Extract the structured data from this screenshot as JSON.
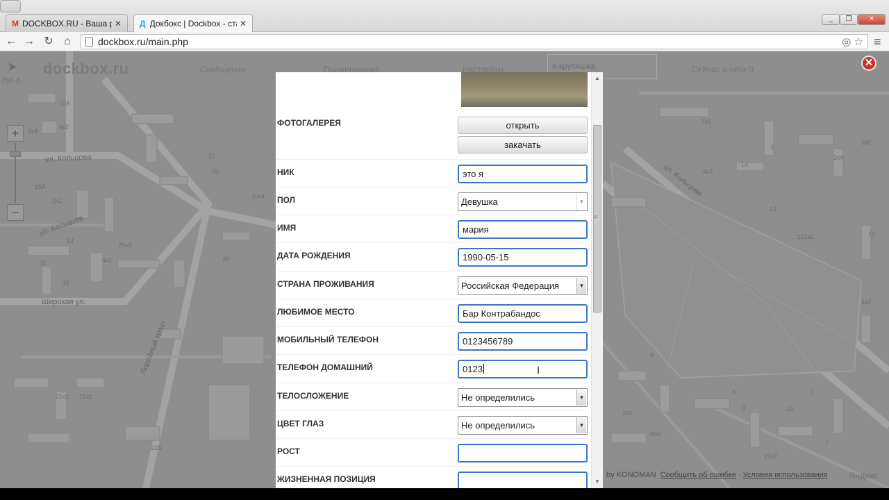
{
  "browser": {
    "tabs": [
      {
        "title": "DOCKBOX.RU - Ваша рег",
        "active": false
      },
      {
        "title": "Докбокс | Dockbox - стан",
        "active": true
      }
    ],
    "url": "dockbox.ru/main.php"
  },
  "site": {
    "logo": "dockbox.ru",
    "nav": [
      "Сообщения",
      "Подмигивания",
      "Настройки"
    ],
    "user_box": "я крутяшка",
    "online": "Сейчас в сети 0"
  },
  "map": {
    "layer": "Луг-3",
    "streets": [
      "ул. Кольцова",
      "ул. Кольцова",
      "Широкая ул.",
      "Лодейный тракт",
      "ул. Кольцова"
    ],
    "house_numbers": [
      "10A",
      "8к2",
      "8к4",
      "27",
      "15A",
      "2к1",
      "30",
      "30к4",
      "14",
      "25к3",
      "26",
      "4к2",
      "33",
      "16",
      "21к2",
      "21к1",
      "22A",
      "7к2",
      "13",
      "113к2",
      "2к2",
      "2к4",
      "6",
      "4к3",
      "14",
      "13",
      "4к2",
      "13",
      "2к2",
      "40к1",
      "6",
      "8",
      "1",
      "3",
      "7",
      "21к2"
    ],
    "footer": {
      "by": "by KONOMAN",
      "report": "Сообщить об ошибке",
      "terms": "Условия использования",
      "yandex": "Яндекс"
    }
  },
  "profile": {
    "gallery_label": "ФОТОГАЛЕРЕЯ",
    "open_button": "открыть",
    "upload_button": "закачать",
    "fields": [
      {
        "label": "НИК",
        "type": "input",
        "value": "это я"
      },
      {
        "label": "ПОЛ",
        "type": "select",
        "value": "Девушка"
      },
      {
        "label": "ИМЯ",
        "type": "input",
        "value": "мария"
      },
      {
        "label": "ДАТА РОЖДЕНИЯ",
        "type": "input",
        "value": "1990-05-15"
      },
      {
        "label": "СТРАНА ПРОЖИВАНИЯ",
        "type": "select",
        "value": "Российская Федерация"
      },
      {
        "label": "ЛЮБИМОЕ МЕСТО",
        "type": "input",
        "value": "Бар Контрабандос"
      },
      {
        "label": "МОБИЛЬНЫЙ ТЕЛЕФОН",
        "type": "input",
        "value": "0123456789"
      },
      {
        "label": "ТЕЛЕФОН ДОМАШНИЙ",
        "type": "input",
        "value": "0123"
      },
      {
        "label": "ТЕЛОСЛОЖЕНИЕ",
        "type": "select",
        "value": "Не определились"
      },
      {
        "label": "ЦВЕТ ГЛАЗ",
        "type": "select",
        "value": "Не определились"
      },
      {
        "label": "РОСТ",
        "type": "input",
        "value": ""
      },
      {
        "label": "ЖИЗНЕННАЯ ПОЗИЦИЯ",
        "type": "input",
        "value": ""
      }
    ]
  },
  "colors": {
    "focus_border": "#3a76c7",
    "close_red": "#cc2d2d",
    "map_gray": "#8e8e8e"
  }
}
